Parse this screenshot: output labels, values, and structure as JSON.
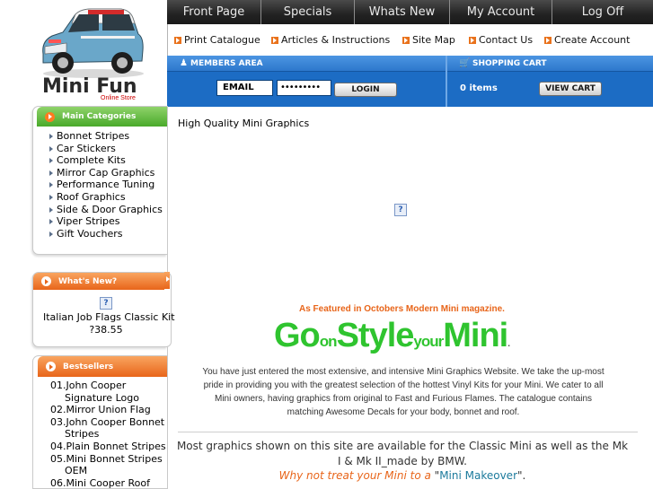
{
  "logo": {
    "title": "Mini Fun",
    "subtitle": "Online Store"
  },
  "nav": {
    "tabs": [
      "Front Page",
      "Specials",
      "Whats New",
      "My Account",
      "Log Off"
    ],
    "sublinks": [
      "Print Catalogue",
      "Articles & Instructions",
      "Site Map",
      "Contact Us",
      "Create Account"
    ]
  },
  "members": {
    "title": "MEMBERS AREA",
    "email_value": "EMAIL",
    "password_value": "•••••••••",
    "login_label": "LOGIN"
  },
  "cart": {
    "title": "SHOPPING CART",
    "items": "0 items",
    "view_label": "VIEW CART"
  },
  "categories": {
    "title": "Main Categories",
    "items": [
      "Bonnet Stripes",
      "Car Stickers",
      "Complete Kits",
      "Mirror Cap Graphics",
      "Performance Tuning",
      "Roof Graphics",
      "Side & Door Graphics",
      "Viper Stripes",
      "Gift Vouchers"
    ]
  },
  "whatsnew": {
    "title": "What's New?",
    "product_name": "Italian Job Flags Classic Kit",
    "product_price": "?38.55",
    "img_glyph": "?"
  },
  "bestsellers": {
    "title": "Bestsellers",
    "lines": [
      "01.John Cooper",
      "Signature Logo",
      "02.Mirror Union Flag",
      "03.John Cooper Bonnet",
      "Stripes",
      "04.Plain Bonnet Stripes",
      "05.Mini Bonnet Stripes",
      "OEM",
      "06.Mini Cooper Roof"
    ]
  },
  "main": {
    "page_title": "High Quality Mini Graphics",
    "img_glyph": "?",
    "featured": "As Featured in Octobers Modern Mini magazine.",
    "slogan": {
      "go": "Go",
      "on": "on",
      "style": "Style",
      "your": "your",
      "mini": "Mini",
      "dot": "."
    },
    "intro": "You have just entered the most extensive, and intensive Mini Graphics Website. We take the up-most pride in providing you with the greatest selection of the hottest Vinyl Kits for your Mini. We cater to all Mini owners, having graphics from original to Fast and Furious Flames. The catalogue contains matching Awesome Decals for your body, bonnet and roof.",
    "compat": "Most graphics shown on this site are available for the Classic Mini as well as the Mk I & Mk II_made by BMW.",
    "makeover_prefix": "Why not treat your Mini to a ",
    "makeover_quote_open": "\"",
    "makeover_link": "Mini Makeover",
    "makeover_quote_close": "\".",
    "colors": {
      "accent_orange": "#e8651a",
      "slogan_green": "#2fc42f",
      "bar_blue": "#1c6cc4",
      "head_green": "#49a92a"
    }
  }
}
